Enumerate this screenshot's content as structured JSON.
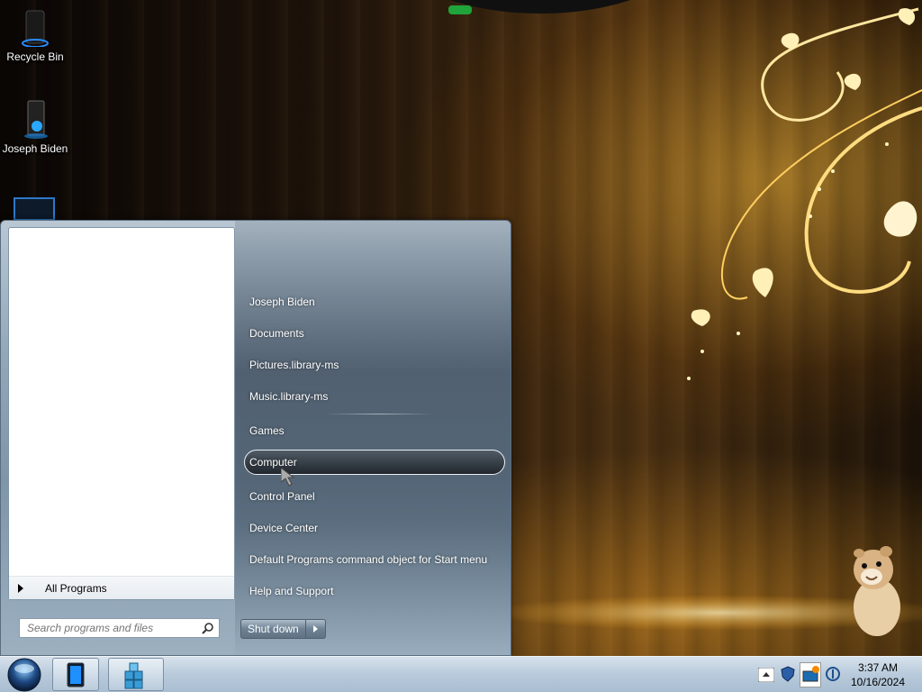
{
  "desktop": {
    "icons": [
      {
        "label": "Recycle Bin"
      },
      {
        "label": "Joseph Biden"
      }
    ]
  },
  "start_menu": {
    "all_programs": "All Programs",
    "search": {
      "placeholder": "Search programs and files"
    },
    "right_items": [
      "Joseph Biden",
      "Documents",
      "Pictures.library-ms",
      "Music.library-ms",
      "Games",
      "Computer",
      "Control Panel",
      "Device Center",
      "Default Programs command object for Start menu",
      "Help and Support"
    ],
    "highlighted_item": "Computer",
    "shutdown_label": "Shut down"
  },
  "taskbar": {
    "clock_time": "3:37 AM",
    "clock_date": "10/16/2024"
  }
}
